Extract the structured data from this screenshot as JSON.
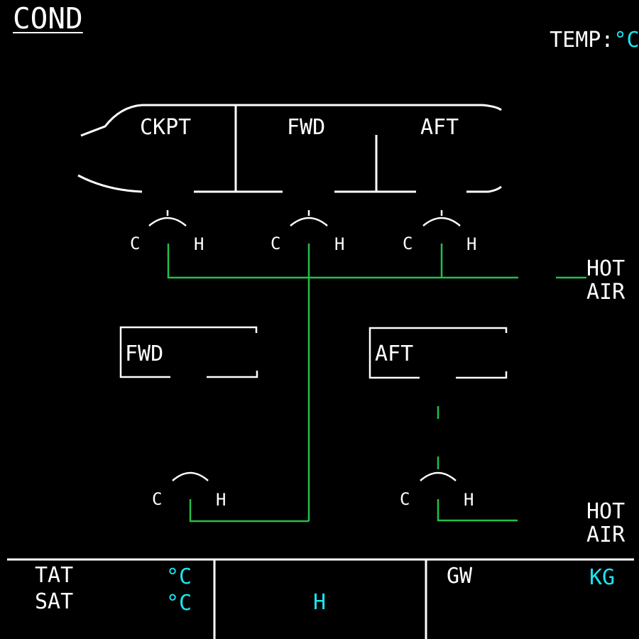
{
  "page": {
    "title": "COND"
  },
  "header": {
    "temp_label": "TEMP",
    "temp_sep": ":",
    "temp_unit": "°C"
  },
  "cabin": {
    "zones": [
      {
        "label": "CKPT",
        "valve_cold": "C",
        "valve_hot": "H"
      },
      {
        "label": "FWD",
        "valve_cold": "C",
        "valve_hot": "H"
      },
      {
        "label": "AFT",
        "valve_cold": "C",
        "valve_hot": "H"
      }
    ],
    "hot_air": [
      "HOT",
      "AIR"
    ]
  },
  "cargo": {
    "compartments": [
      {
        "label": "FWD",
        "valve_cold": "C",
        "valve_hot": "H"
      },
      {
        "label": "AFT",
        "valve_cold": "C",
        "valve_hot": "H"
      }
    ],
    "hot_air": [
      "HOT",
      "AIR"
    ]
  },
  "status_bar": {
    "tat_label": "TAT",
    "tat_unit": "°C",
    "sat_label": "SAT",
    "sat_unit": "°C",
    "time_unit": "H",
    "gw_label": "GW",
    "gw_unit": "KG"
  },
  "colors": {
    "line_white": "#ffffff",
    "line_green": "#22c04a",
    "value_cyan": "#19e6f0",
    "background": "#000000"
  }
}
